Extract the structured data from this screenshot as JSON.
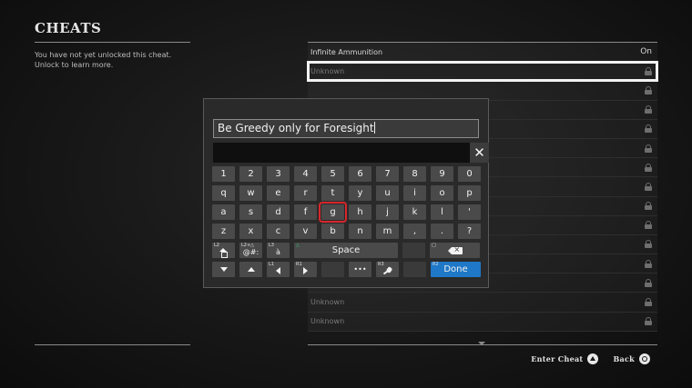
{
  "page": {
    "title": "CHEATS",
    "description": "You have not yet unlocked this cheat.\nUnlock to learn more."
  },
  "cheats": [
    {
      "name": "Infinite Ammunition",
      "value": "On",
      "unlocked": true
    },
    {
      "name": "Unknown",
      "locked": true,
      "selected": true
    },
    {
      "name": "",
      "locked": true
    },
    {
      "name": "",
      "locked": true
    },
    {
      "name": "",
      "locked": true
    },
    {
      "name": "",
      "locked": true
    },
    {
      "name": "",
      "locked": true
    },
    {
      "name": "",
      "locked": true
    },
    {
      "name": "",
      "locked": true
    },
    {
      "name": "",
      "locked": true
    },
    {
      "name": "",
      "locked": true
    },
    {
      "name": "",
      "locked": true
    },
    {
      "name": "Unknown",
      "locked": true
    },
    {
      "name": "Unknown",
      "locked": true
    },
    {
      "name": "Unknown",
      "locked": true
    }
  ],
  "keyboard": {
    "input_value": "Be Greedy only for Foresight",
    "close_label": "✕",
    "row1": [
      "1",
      "2",
      "3",
      "4",
      "5",
      "6",
      "7",
      "8",
      "9",
      "0"
    ],
    "row2": [
      "q",
      "w",
      "e",
      "r",
      "t",
      "y",
      "u",
      "i",
      "o",
      "p"
    ],
    "row3": [
      "a",
      "s",
      "d",
      "f",
      "g",
      "h",
      "j",
      "k",
      "l",
      "'"
    ],
    "row4": [
      "z",
      "x",
      "c",
      "v",
      "b",
      "n",
      "m",
      ",",
      ".",
      "?"
    ],
    "selected_key": "g",
    "space_label": "Space",
    "done_label": "Done",
    "symbols_label": "@#:",
    "accent_label": "à",
    "more_label": "•••",
    "tags": {
      "shift": "L2",
      "symbols": "L2+△",
      "accent": "L3",
      "space": "△",
      "backspace": "□",
      "cursor_left": "L1",
      "cursor_right": "R1",
      "mic": "R3",
      "done": "R2"
    }
  },
  "footer": {
    "enter_cheat_label": "Enter Cheat",
    "back_label": "Back",
    "enter_cheat_button": "triangle-button-icon",
    "back_button": "circle-button-icon"
  },
  "colors": {
    "background": "#151515",
    "done_key": "#1f78c8",
    "selected_key_outline": "#d8262b",
    "selected_row_outline": "#f2f2f2",
    "triangle_hint": "#36c07a"
  }
}
